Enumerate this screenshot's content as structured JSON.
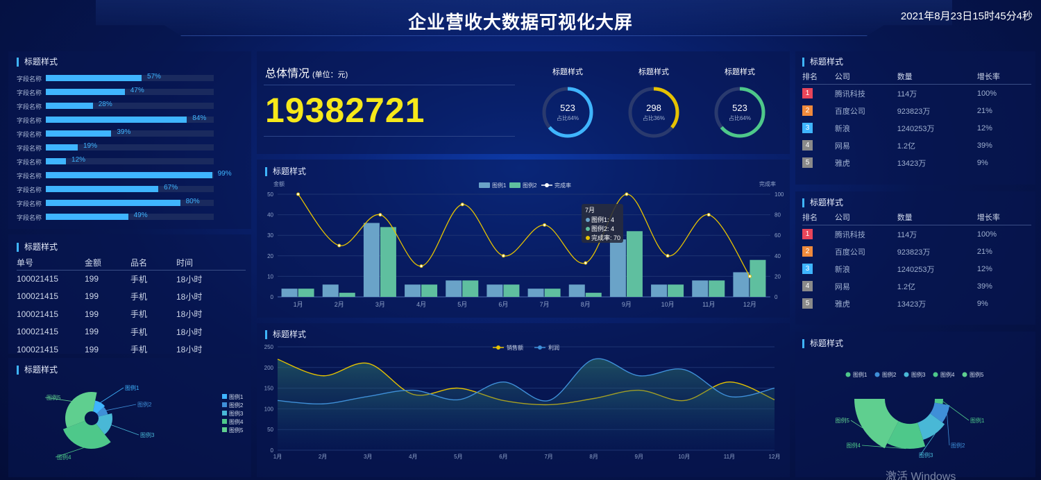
{
  "header": {
    "title": "企业营收大数据可视化大屏",
    "clock": "2021年8月23日15时45分4秒"
  },
  "left_bars": {
    "title": "标题样式",
    "items": [
      {
        "label": "字段名称",
        "pct": "57%",
        "value": 57
      },
      {
        "label": "字段名称",
        "pct": "47%",
        "value": 47
      },
      {
        "label": "字段名称",
        "pct": "28%",
        "value": 28
      },
      {
        "label": "字段名称",
        "pct": "84%",
        "value": 84
      },
      {
        "label": "字段名称",
        "pct": "39%",
        "value": 39
      },
      {
        "label": "字段名称",
        "pct": "19%",
        "value": 19
      },
      {
        "label": "字段名称",
        "pct": "12%",
        "value": 12
      },
      {
        "label": "字段名称",
        "pct": "99%",
        "value": 99
      },
      {
        "label": "字段名称",
        "pct": "67%",
        "value": 67
      },
      {
        "label": "字段名称",
        "pct": "80%",
        "value": 80
      },
      {
        "label": "字段名称",
        "pct": "49%",
        "value": 49
      }
    ]
  },
  "orders": {
    "title": "标题样式",
    "headers": [
      "单号",
      "金额",
      "品名",
      "时间"
    ],
    "rows": [
      [
        "100021415",
        "199",
        "手机",
        "18小时"
      ],
      [
        "100021415",
        "199",
        "手机",
        "18小时"
      ],
      [
        "100021415",
        "199",
        "手机",
        "18小时"
      ],
      [
        "100021415",
        "199",
        "手机",
        "18小时"
      ]
    ]
  },
  "left_pie": {
    "title": "标题样式",
    "legend": [
      "图例1",
      "图例2",
      "图例3",
      "图例4",
      "图例5"
    ]
  },
  "overall": {
    "label": "总体情况",
    "unit": "(单位：元)",
    "value": "19382721"
  },
  "rings": [
    {
      "label": "标题样式",
      "value": "523",
      "sub": "占比64%",
      "pct": 64,
      "color": "#3fb5ff"
    },
    {
      "label": "标题样式",
      "value": "298",
      "sub": "占比36%",
      "pct": 36,
      "color": "#e6c200"
    },
    {
      "label": "标题样式",
      "value": "523",
      "sub": "占比64%",
      "pct": 64,
      "color": "#4ec88a"
    }
  ],
  "mid_chart": {
    "title": "标题样式",
    "tooltip": {
      "title": "7月",
      "l1": "图例1: 4",
      "l2": "图例2: 4",
      "l3": "完成率: 70"
    }
  },
  "area_chart_title": "标题样式",
  "rank1": {
    "title": "标题样式",
    "headers": [
      "排名",
      "公司",
      "数量",
      "增长率"
    ],
    "rows": [
      {
        "rank": "1",
        "company": "腾讯科技",
        "qty": "114万",
        "growth": "100%",
        "color": "#e8455a"
      },
      {
        "rank": "2",
        "company": "百度公司",
        "qty": "923823万",
        "growth": "21%",
        "color": "#f08a3c"
      },
      {
        "rank": "3",
        "company": "新浪",
        "qty": "1240253万",
        "growth": "12%",
        "color": "#3fb5ff"
      },
      {
        "rank": "4",
        "company": "网易",
        "qty": "1.2亿",
        "growth": "39%",
        "color": "#8a8a8a"
      },
      {
        "rank": "5",
        "company": "雅虎",
        "qty": "13423万",
        "growth": "9%",
        "color": "#8a8a8a"
      }
    ]
  },
  "rank2": {
    "title": "标题样式",
    "headers": [
      "排名",
      "公司",
      "数量",
      "增长率"
    ],
    "rows": [
      {
        "rank": "1",
        "company": "腾讯科技",
        "qty": "114万",
        "growth": "100%",
        "color": "#e8455a"
      },
      {
        "rank": "2",
        "company": "百度公司",
        "qty": "923823万",
        "growth": "21%",
        "color": "#f08a3c"
      },
      {
        "rank": "3",
        "company": "新浪",
        "qty": "1240253万",
        "growth": "12%",
        "color": "#3fb5ff"
      },
      {
        "rank": "4",
        "company": "网易",
        "qty": "1.2亿",
        "growth": "39%",
        "color": "#8a8a8a"
      },
      {
        "rank": "5",
        "company": "雅虎",
        "qty": "13423万",
        "growth": "9%",
        "color": "#8a8a8a"
      }
    ]
  },
  "right_pie": {
    "title": "标题样式",
    "legend": [
      "图例1",
      "图例2",
      "图例3",
      "图例4",
      "图例5"
    ]
  },
  "watermark": "激活 Windows",
  "chart_data": [
    {
      "type": "bar",
      "categories": [
        "1月",
        "2月",
        "3月",
        "4月",
        "5月",
        "6月",
        "7月",
        "8月",
        "9月",
        "10月",
        "11月",
        "12月"
      ],
      "series": [
        {
          "name": "图例1",
          "values": [
            4,
            6,
            36,
            6,
            8,
            6,
            4,
            6,
            28,
            6,
            8,
            12
          ]
        },
        {
          "name": "图例2",
          "values": [
            4,
            2,
            34,
            6,
            8,
            6,
            4,
            2,
            32,
            6,
            8,
            18
          ]
        },
        {
          "name": "完成率",
          "values": [
            100,
            50,
            80,
            30,
            90,
            40,
            70,
            33,
            100,
            40,
            80,
            20
          ]
        }
      ],
      "ylabel": "金额",
      "ylabel_right": "完成率",
      "ylim": [
        0,
        50
      ],
      "ylim_right": [
        0,
        100
      ],
      "yticks": [
        "0",
        "10",
        "20",
        "30",
        "40",
        "50"
      ],
      "yticks_right": [
        "0",
        "20",
        "40",
        "60",
        "80",
        "100"
      ]
    },
    {
      "type": "area",
      "categories": [
        "1月",
        "2月",
        "3月",
        "4月",
        "5月",
        "6月",
        "7月",
        "8月",
        "9月",
        "10月",
        "11月",
        "12月"
      ],
      "series": [
        {
          "name": "销售额",
          "values": [
            220,
            180,
            210,
            135,
            150,
            120,
            110,
            125,
            145,
            120,
            165,
            122
          ]
        },
        {
          "name": "利润",
          "values": [
            120,
            112,
            130,
            145,
            122,
            165,
            120,
            220,
            180,
            195,
            130,
            150
          ]
        }
      ],
      "ylim": [
        0,
        250
      ],
      "yticks": [
        "0",
        "50",
        "100",
        "150",
        "200",
        "250"
      ]
    },
    {
      "type": "pie",
      "labels": [
        "图例1",
        "图例2",
        "图例3",
        "图例4",
        "图例5"
      ],
      "values": [
        10,
        8,
        18,
        30,
        34
      ]
    },
    {
      "type": "pie",
      "labels": [
        "图例1",
        "图例2",
        "图例3",
        "图例4",
        "图例5"
      ],
      "values": [
        5,
        15,
        20,
        25,
        35
      ]
    }
  ]
}
